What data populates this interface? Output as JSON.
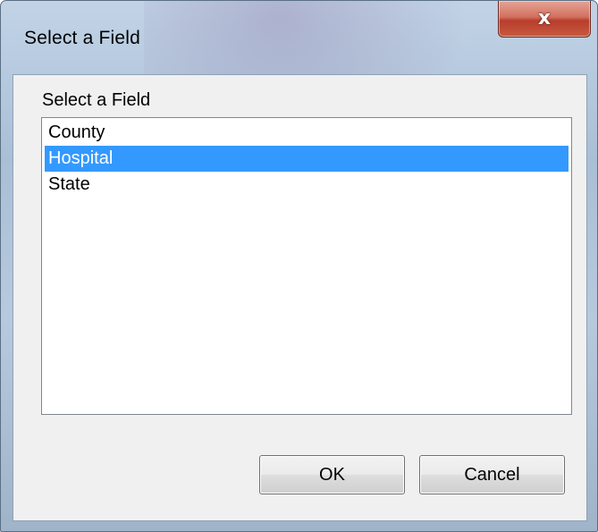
{
  "window": {
    "title": "Select a Field",
    "close_glyph": "x"
  },
  "dialog": {
    "label": "Select a Field",
    "items": [
      {
        "label": "County",
        "selected": false
      },
      {
        "label": "Hospital",
        "selected": true
      },
      {
        "label": "State",
        "selected": false
      }
    ],
    "selected_value": "Hospital"
  },
  "buttons": {
    "ok_label": "OK",
    "cancel_label": "Cancel"
  },
  "colors": {
    "selection_highlight": "#3399ff",
    "close_button": "#c75a3f"
  },
  "icons": {
    "close": "close-icon"
  }
}
